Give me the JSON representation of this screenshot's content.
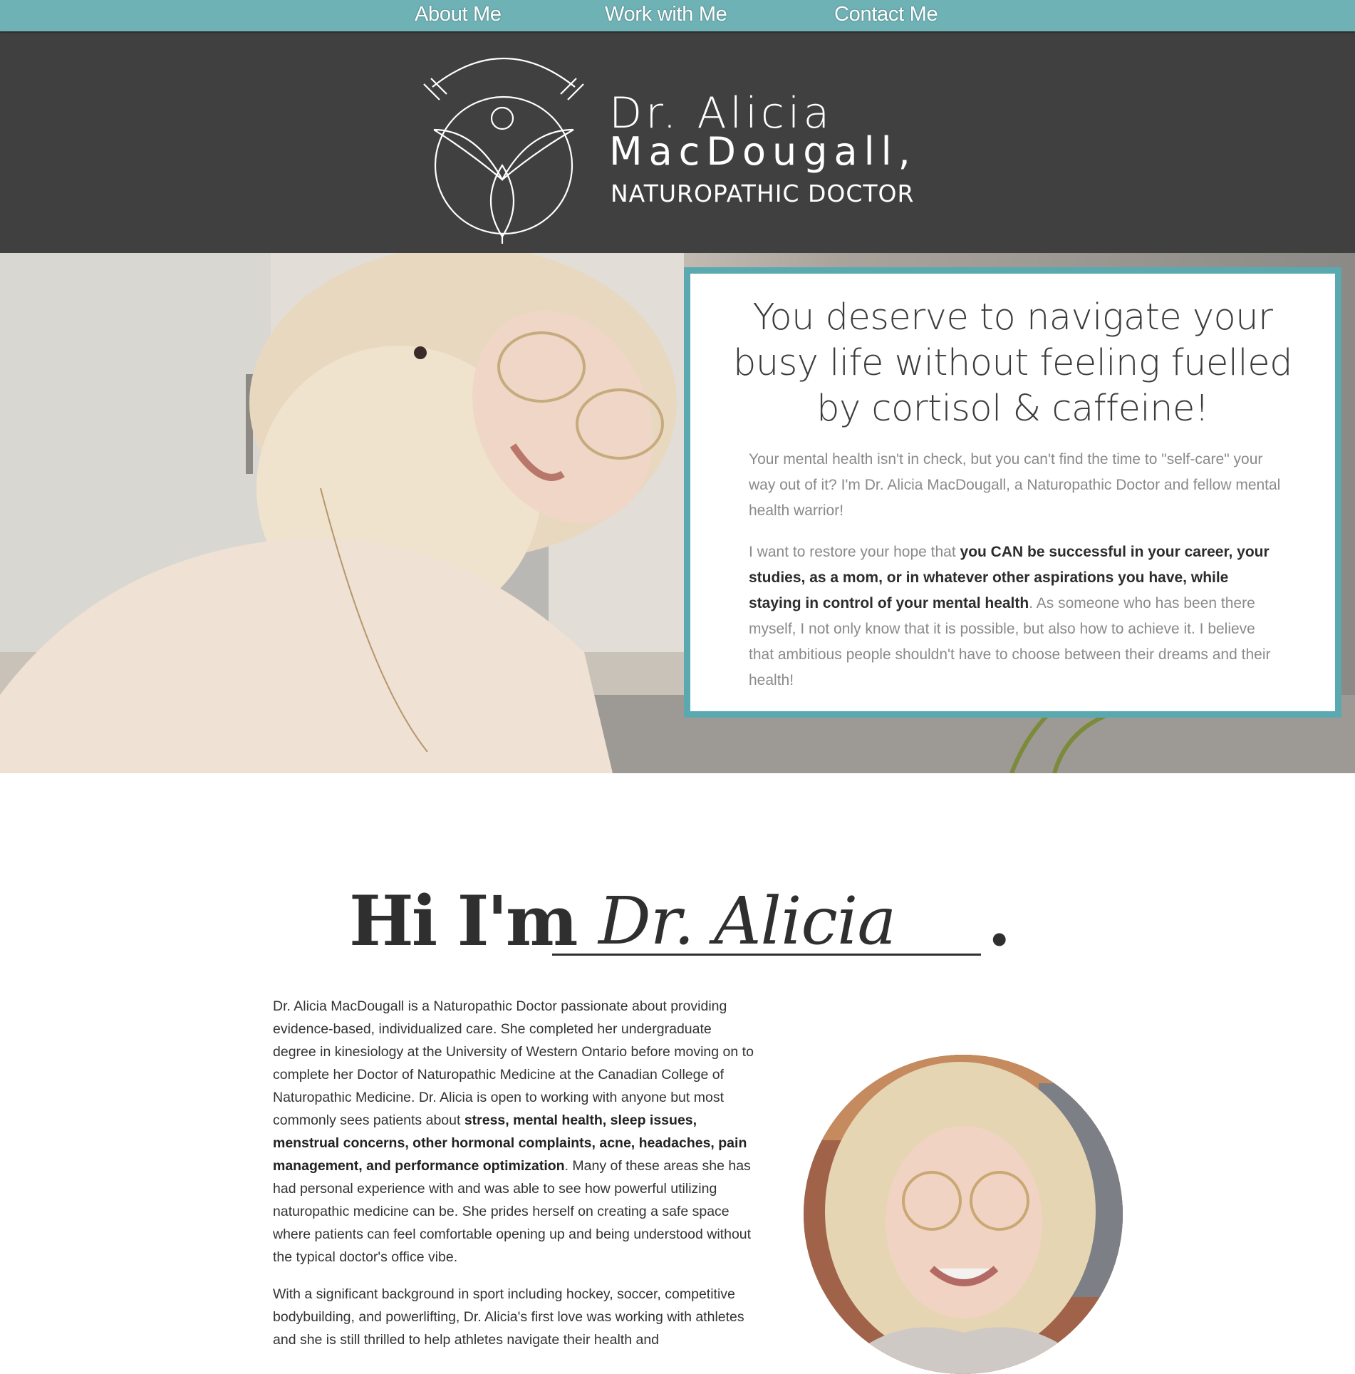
{
  "nav": {
    "items": [
      "About Me",
      "Work with Me",
      "Contact Me"
    ]
  },
  "logo": {
    "line1": "Dr. Alicia",
    "line2": "MacDougall,",
    "line3": "NATUROPATHIC DOCTOR",
    "icon": "lotus-figure-icon"
  },
  "hero": {
    "heading": "You deserve to navigate your busy life without feeling fuelled by cortisol & caffeine!",
    "p1": "Your mental health isn't in check, but you can't find the time to \"self-care\" your way out of it? I'm Dr. Alicia MacDougall, a Naturopathic Doctor and fellow mental health warrior!",
    "p2_lead": "I want to restore your hope that ",
    "p2_bold": "you CAN be successful in your career, your studies, as a mom, or in whatever other aspirations you have, while staying in control of your mental health",
    "p2_tail": ". As someone who has been there myself, I not only know that it is possible, but also how to achieve it. I believe that ambitious people shouldn't have to choose between their dreams and their health!"
  },
  "about": {
    "heading_prefix": "Hi I'm",
    "heading_name": "Dr. Alicia",
    "heading_period": ".",
    "p1_lead": "Dr. Alicia MacDougall is a Naturopathic Doctor passionate about providing evidence-based, individualized care. She completed her undergraduate degree in kinesiology at the University of Western Ontario before moving on to complete her Doctor of Naturopathic Medicine at the Canadian College of Naturopathic Medicine. Dr. Alicia is open to working with anyone but most commonly sees patients about ",
    "p1_bold": "stress, mental health, sleep issues, menstrual concerns, other hormonal complaints, acne, headaches, pain management, and performance optimization",
    "p1_tail": ". Many of these areas she has had personal experience with and was able to see how powerful utilizing naturopathic medicine can be. She prides herself on creating a safe space where patients can feel comfortable opening up and being understood without the typical doctor's office vibe.",
    "p2": "With a significant background in sport including hockey, soccer, competitive bodybuilding, and powerlifting, Dr. Alicia's first love was working with athletes and she is still thrilled to help athletes navigate their health and"
  },
  "colors": {
    "nav_bg": "#6fb2b6",
    "header_bg": "#404040",
    "card_border": "#5aa9b0"
  }
}
